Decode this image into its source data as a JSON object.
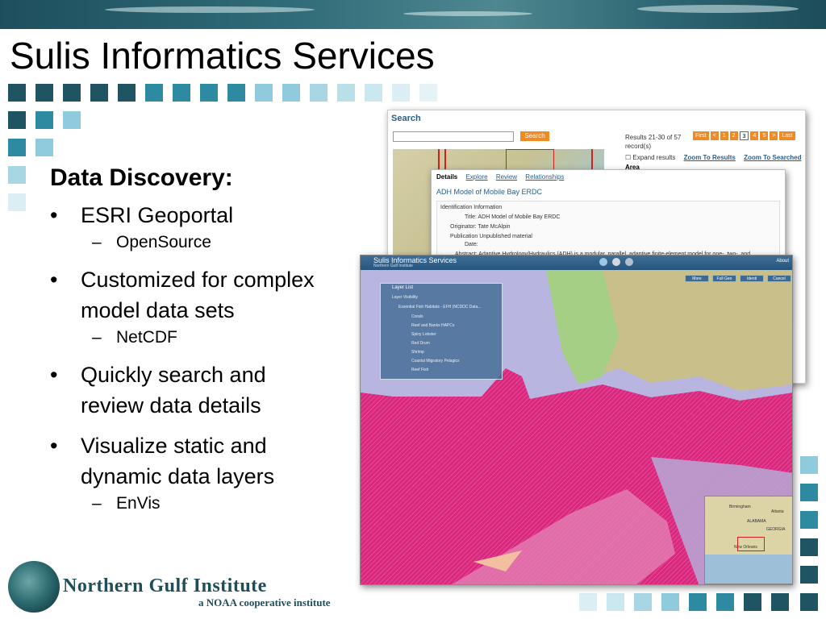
{
  "slide": {
    "title": "Sulis Informatics Services",
    "heading": "Data Discovery:",
    "bullets": [
      {
        "text": "ESRI Geoportal",
        "sub": "OpenSource"
      },
      {
        "text": "Customized for complex model data sets",
        "sub": "NetCDF"
      },
      {
        "text": "Quickly search and review data details",
        "sub": ""
      },
      {
        "text": "Visualize static and dynamic data layers",
        "sub": "EnVis"
      }
    ]
  },
  "search_panel": {
    "title": "Search",
    "search_button": "Search",
    "results": "Results 21-30 of 57 record(s)",
    "pager": [
      "First",
      "<",
      "1",
      "2",
      "3",
      "4",
      "5",
      ">",
      "Last"
    ],
    "expand_results": "Expand results",
    "zoom_results": "Zoom To Results",
    "zoom_searched": "Zoom To Searched",
    "area": "Area"
  },
  "detail_panel": {
    "tabs": [
      "Details",
      "Explore",
      "Review",
      "Relationships"
    ],
    "title": "ADH Model of Mobile Bay ERDC",
    "section": "Identification Information",
    "title_row": "Title: ADH Model of Mobile Bay ERDC",
    "originator": "Originator: Tate McAlpin",
    "publication": "Publication Unpublished material",
    "date": "Date:",
    "abstract": "Abstract: Adaptive Hydrology/Hydraulics (ADH) is a modular, parallel, adaptive finite-element model for one-, two-, and"
  },
  "map_panel": {
    "title": "Sulis Informatics Services",
    "subtitle": "Northern Gulf Institute",
    "about": "About",
    "buttons": [
      "More",
      "Full Geo",
      "Identi",
      "Cancel"
    ],
    "layer_list_title": "Layer List",
    "layer_visibility": "Layer Visibility",
    "layers": [
      "Essential Fish Habitats - EFH (NCDDC Data...",
      "Corals",
      "Reef and Banks HAPCs",
      "Spiny Lobster",
      "Red Drum",
      "Shrimp",
      "Coastal Migratory Pelagics",
      "Reef Fish"
    ],
    "overview_labels": [
      "Birmingham",
      "Atlanta",
      "ALABAMA",
      "GEORGIA",
      "New Orleans"
    ]
  },
  "logo": {
    "name": "Northern Gulf Institute",
    "subtitle": "a NOAA cooperative institute"
  },
  "colors": {
    "dark_teal": "#1f5563",
    "mid_teal": "#2e8aa0",
    "light_teal": "#8fcbdc",
    "pale_teal": "#dbeef4",
    "habitat_magenta": "#d9297f"
  }
}
